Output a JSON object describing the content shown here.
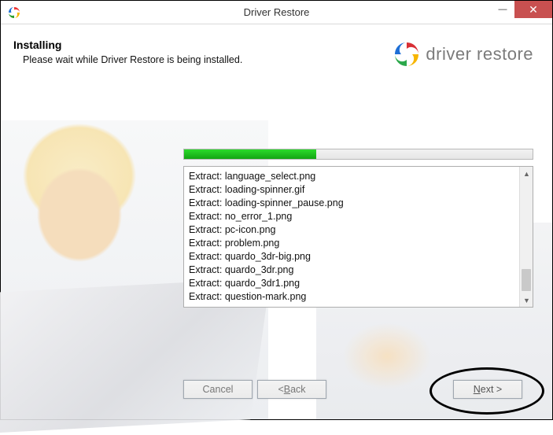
{
  "window": {
    "title": "Driver Restore"
  },
  "header": {
    "title": "Installing",
    "subtitle": "Please wait while Driver Restore is being installed."
  },
  "brand": {
    "name": "driver restore"
  },
  "progress": {
    "percent": 38
  },
  "log": {
    "lines": [
      "Extract: language_select.png",
      "Extract: loading-spinner.gif",
      "Extract: loading-spinner_pause.png",
      "Extract: no_error_1.png",
      "Extract: pc-icon.png",
      "Extract: problem.png",
      "Extract: quardo_3dr-big.png",
      "Extract: quardo_3dr.png",
      "Extract: quardo_3dr1.png",
      "Extract: question-mark.png"
    ]
  },
  "buttons": {
    "cancel": "Cancel",
    "back": "< Back",
    "next": "Next >",
    "back_prefix": "< ",
    "back_letter": "B",
    "back_rest": "ack",
    "next_letter": "N",
    "next_rest": "ext >"
  }
}
